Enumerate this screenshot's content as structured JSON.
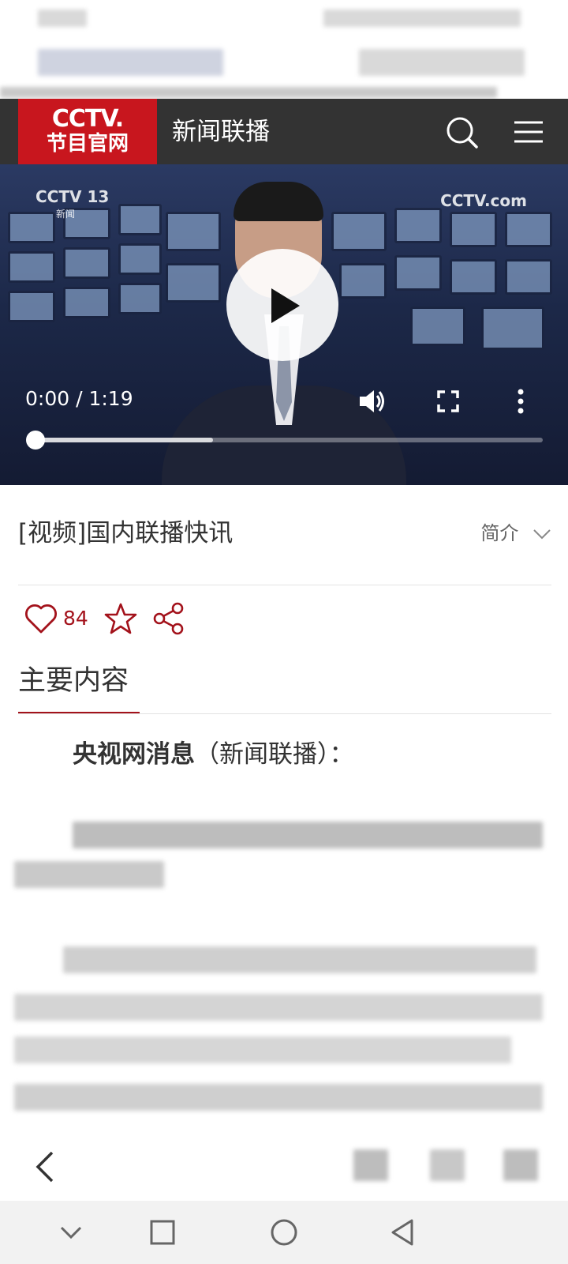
{
  "header": {
    "logo_line1": "CCTV.",
    "logo_line2": "节目官网",
    "title": "新闻联播",
    "search_icon": "search-icon",
    "menu_icon": "menu-icon"
  },
  "video": {
    "channel_logo": "CCTV 13",
    "channel_sub": "新闻",
    "watermark": "CCTV.com",
    "time": "0:00 / 1:19",
    "progress_fraction": 0,
    "buffered_fraction": 0.35,
    "controls": [
      "play-icon",
      "volume-icon",
      "fullscreen-icon",
      "more-icon"
    ]
  },
  "article": {
    "title": "[视频]国内联播快讯",
    "intro_label": "简介",
    "like_count": "84",
    "tab_label": "主要内容",
    "lead_bold": "央视网消息",
    "lead_rest": "（新闻联播）："
  },
  "colors": {
    "brand_red": "#c8161e",
    "accent_red": "#a3121b",
    "header_bg": "#333333"
  }
}
